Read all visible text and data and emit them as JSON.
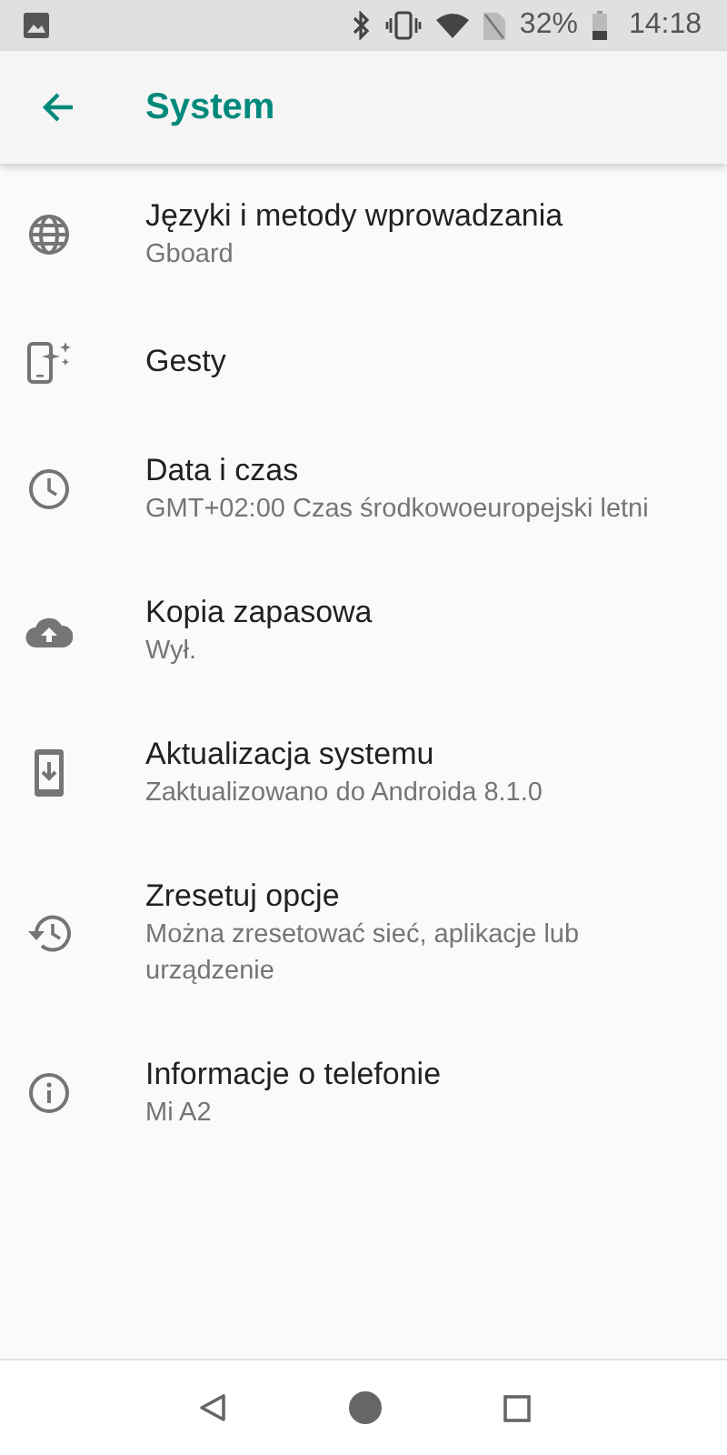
{
  "status_bar": {
    "battery": "32%",
    "time": "14:18"
  },
  "app_bar": {
    "title": "System"
  },
  "items": [
    {
      "kind": "globe",
      "title": "Języki i metody wprowadzania",
      "summary": "Gboard"
    },
    {
      "kind": "gestures",
      "title": "Gesty"
    },
    {
      "kind": "clock",
      "title": "Data i czas",
      "summary": "GMT+02:00 Czas środkowoeuropejski letni"
    },
    {
      "kind": "backup",
      "title": "Kopia zapasowa",
      "summary": "Wył."
    },
    {
      "kind": "update",
      "title": "Aktualizacja systemu",
      "summary": "Zaktualizowano do Androida 8.1.0"
    },
    {
      "kind": "reset",
      "title": "Zresetuj opcje",
      "summary": "Można zresetować sieć, aplikacje lub urządzenie"
    },
    {
      "kind": "info",
      "title": "Informacje o telefonie",
      "summary": "Mi A2"
    }
  ]
}
